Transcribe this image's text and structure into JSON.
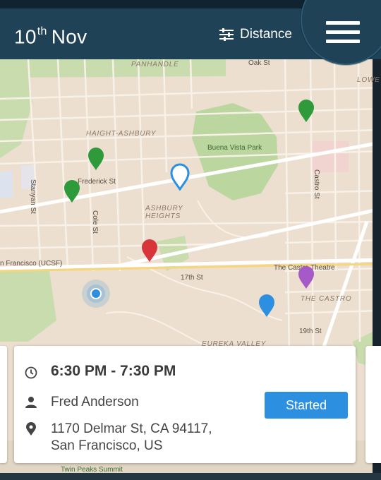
{
  "header": {
    "date_day": "10",
    "date_suffix": "th",
    "date_month": "Nov",
    "sort_label": "Distance"
  },
  "map": {
    "areas": [
      "PANHANDLE",
      "HAIGHT-ASHBURY",
      "ASHBURY HEIGHTS",
      "THE CASTRO",
      "EUREKA VALLEY",
      "LOWE"
    ],
    "streets": [
      "Oak St",
      "Frederick St",
      "Stanyan St",
      "Cole St",
      "Castro St",
      "17th St",
      "19th St"
    ],
    "places": [
      "Buena Vista Park",
      "n Francisco (UCSF)",
      "The Castro Theatre",
      "Twin Peaks Summit"
    ],
    "marker_colors": {
      "green": "#2e9a3a",
      "red": "#d8353a",
      "blue": "#2d8fe0",
      "purple": "#a65ac8",
      "selected_outline": "#2d8fe0",
      "user_location": "#2d8fe0"
    }
  },
  "card": {
    "time": "6:30 PM - 7:30 PM",
    "name": "Fred Anderson",
    "address_line1": "1170 Delmar St, CA 94117,",
    "address_line2": "San Francisco, US",
    "status_button": "Started"
  }
}
